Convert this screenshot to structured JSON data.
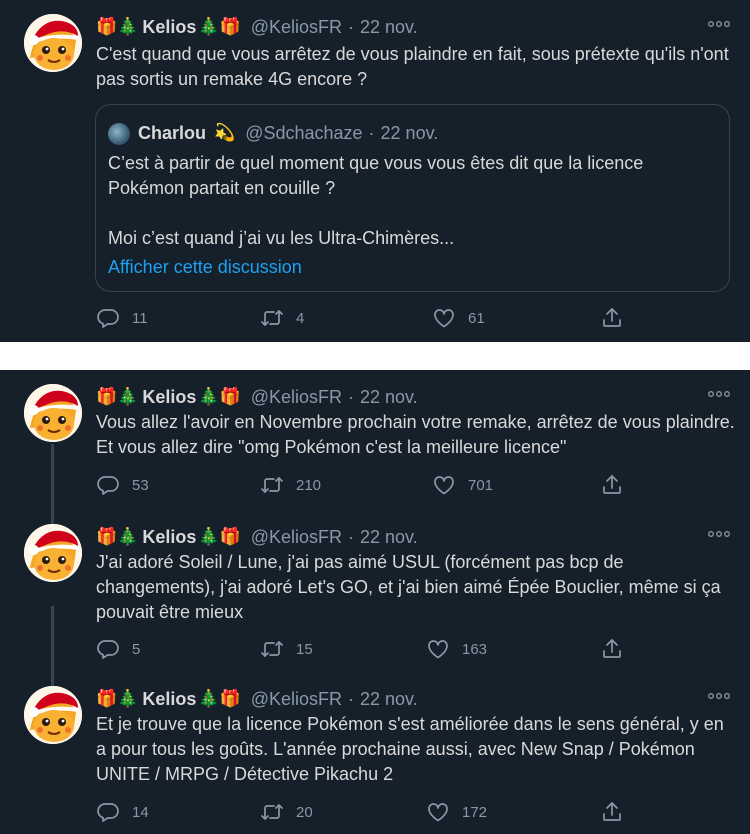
{
  "colors": {
    "background": "#15202b",
    "text": "#d9d9d9",
    "muted": "#8899a6",
    "link": "#1da1f2",
    "border": "#38444d"
  },
  "author": {
    "emoji_left": "🎁🎄",
    "name": "Kelios",
    "emoji_right": "🎄🎁",
    "handle": "@KeliosFR"
  },
  "separator": "·",
  "tweets": [
    {
      "date": "22 nov.",
      "text": "C'est quand que vous arrêtez de vous plaindre en fait, sous prétexte qu'ils n'ont pas sortis un remake 4G encore ?",
      "quote": {
        "name": "Charlou",
        "emoji": "💫",
        "handle": "@Sdchachaze",
        "date": "22 nov.",
        "text_line1": "C’est à partir de quel moment que vous vous êtes dit que la licence Pokémon partait en couille ?",
        "text_line2": "Moi c’est quand j’ai vu les Ultra-Chimères...",
        "link": "Afficher cette discussion"
      },
      "replies": "11",
      "retweets": "4",
      "likes": "61"
    },
    {
      "date": "22 nov.",
      "text": "Vous allez l'avoir en Novembre prochain votre remake, arrêtez de vous plaindre. Et vous allez dire \"omg Pokémon c'est la meilleure licence\"",
      "replies": "53",
      "retweets": "210",
      "likes": "701"
    },
    {
      "date": "22 nov.",
      "text": "J'ai adoré Soleil / Lune, j'ai pas aimé USUL (forcément pas bcp de changements), j'ai adoré Let's GO, et j'ai bien aimé Épée Bouclier, même si ça pouvait être mieux",
      "replies": "5",
      "retweets": "15",
      "likes": "163"
    },
    {
      "date": "22 nov.",
      "text": "Et je trouve que la licence Pokémon s'est améliorée dans le sens général, y en a pour tous les goûts. L'année prochaine aussi, avec New Snap / Pokémon UNITE / MRPG / Détective Pikachu 2",
      "replies": "14",
      "retweets": "20",
      "likes": "172"
    }
  ],
  "icons": {
    "avatar": "pikachu-santa-avatar",
    "more": "more-dots-icon",
    "reply": "reply-icon",
    "retweet": "retweet-icon",
    "like": "heart-icon",
    "share": "share-icon"
  }
}
